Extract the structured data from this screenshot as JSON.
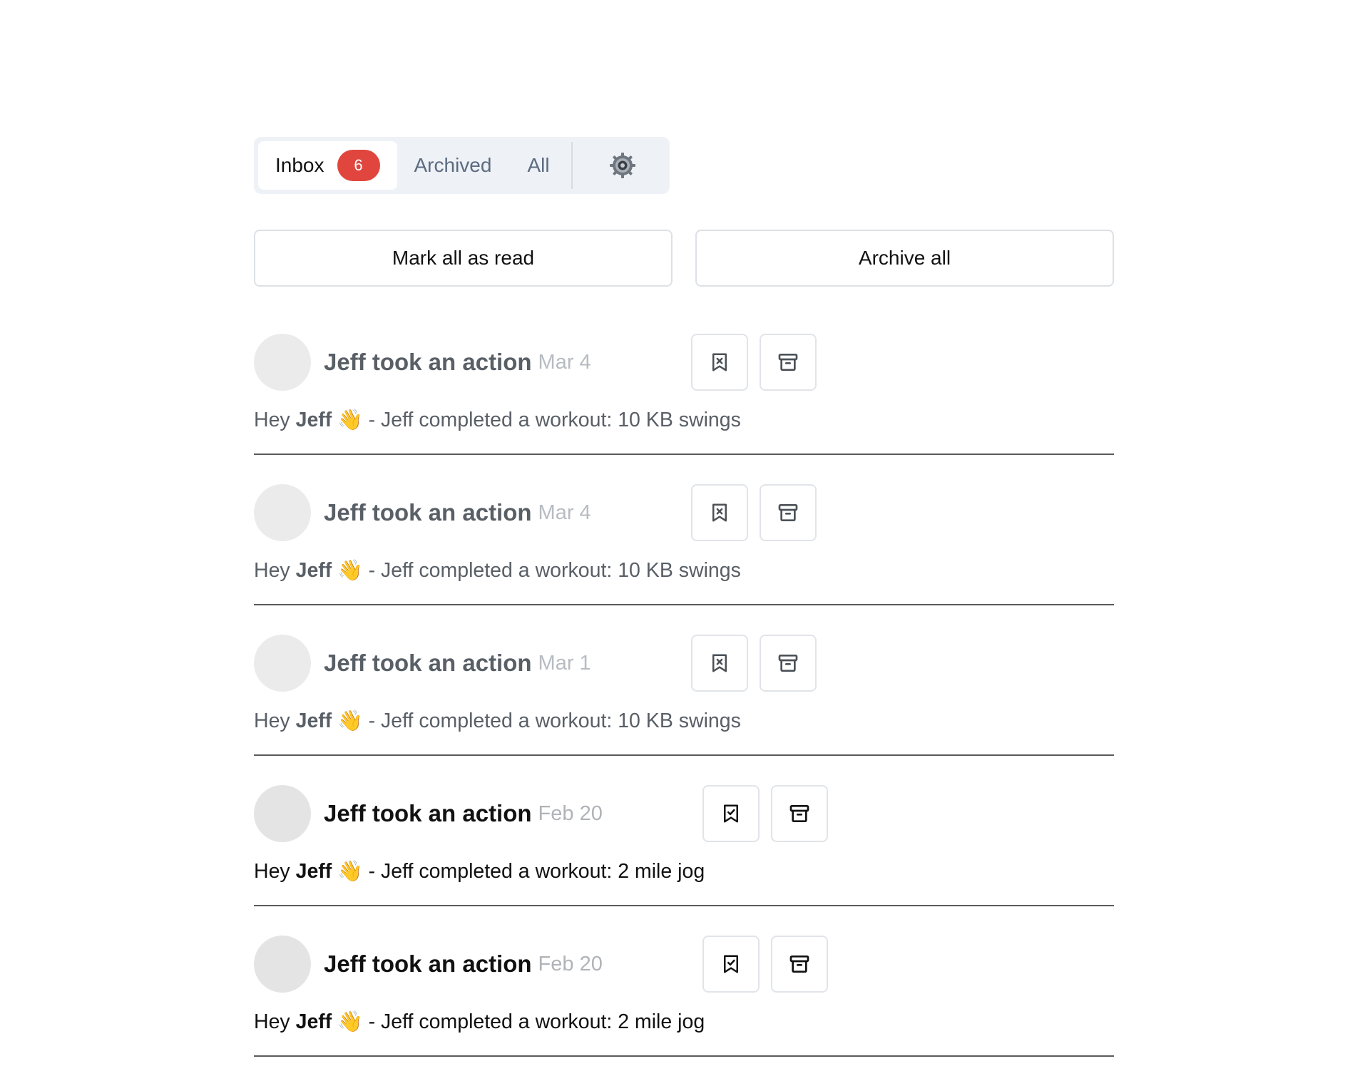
{
  "tabs": {
    "inbox_label": "Inbox",
    "inbox_count": "6",
    "archived_label": "Archived",
    "all_label": "All",
    "settings_icon": "gear-icon"
  },
  "actions": {
    "mark_all_read": "Mark all as read",
    "archive_all": "Archive all"
  },
  "colors": {
    "badge": "#e0463e",
    "tab_bg": "#eef2f7",
    "read_text": "#595f66",
    "unread_text": "#111111"
  },
  "notifications": [
    {
      "title": "Jeff took an action",
      "date": "Mar 4",
      "greeting": "Hey",
      "name": "Jeff",
      "emoji": "👋",
      "message": " - Jeff completed a workout: 10 KB swings",
      "state": "read",
      "icons": [
        "bookmark-x-icon",
        "archive-icon"
      ]
    },
    {
      "title": "Jeff took an action",
      "date": "Mar 4",
      "greeting": "Hey",
      "name": "Jeff",
      "emoji": "👋",
      "message": " - Jeff completed a workout: 10 KB swings",
      "state": "read",
      "icons": [
        "bookmark-x-icon",
        "archive-icon"
      ]
    },
    {
      "title": "Jeff took an action",
      "date": "Mar 1",
      "greeting": "Hey",
      "name": "Jeff",
      "emoji": "👋",
      "message": " - Jeff completed a workout: 10 KB swings",
      "state": "read",
      "icons": [
        "bookmark-x-icon",
        "archive-icon"
      ]
    },
    {
      "title": "Jeff took an action",
      "date": "Feb 20",
      "greeting": "Hey",
      "name": "Jeff",
      "emoji": "👋",
      "message": " - Jeff completed a workout: 2 mile jog",
      "state": "unread",
      "icons": [
        "bookmark-check-icon",
        "archive-icon"
      ]
    },
    {
      "title": "Jeff took an action",
      "date": "Feb 20",
      "greeting": "Hey",
      "name": "Jeff",
      "emoji": "👋",
      "message": " - Jeff completed a workout: 2 mile jog",
      "state": "unread",
      "icons": [
        "bookmark-check-icon",
        "archive-icon"
      ]
    }
  ]
}
